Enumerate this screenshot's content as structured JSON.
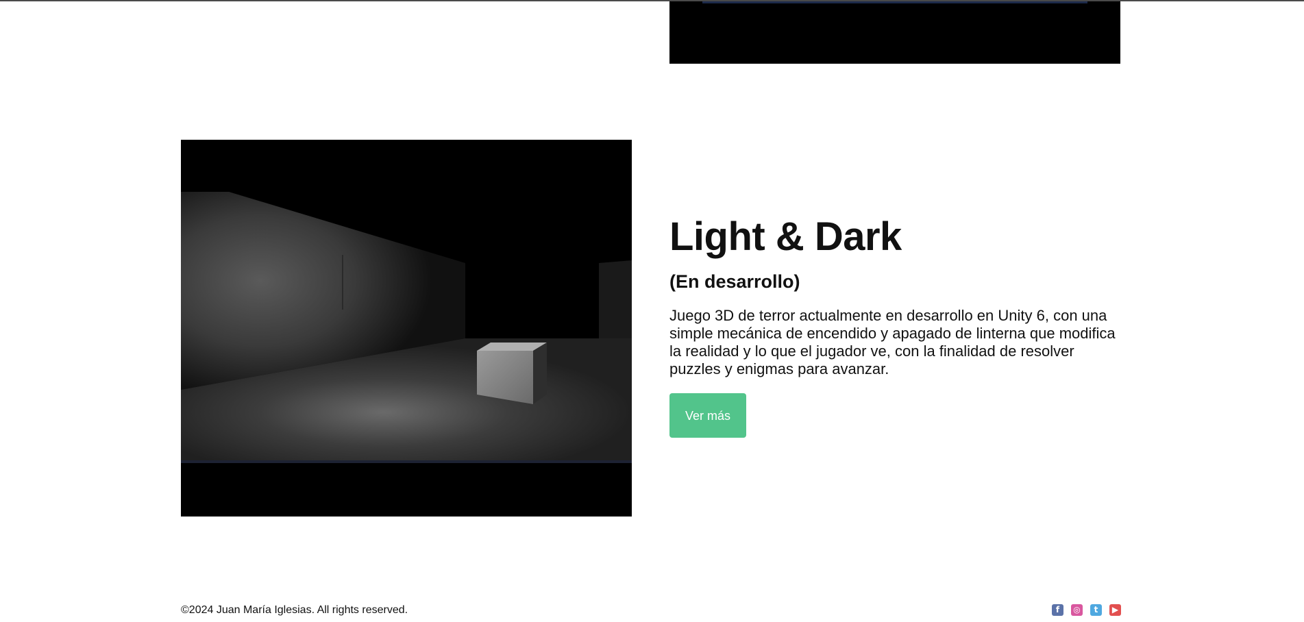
{
  "project": {
    "title": "Light & Dark",
    "status": "(En desarrollo)",
    "description": "Juego 3D de terror actualmente en desarrollo en Unity 6, con una simple mecánica de encendido y apagado de linterna que modifica la realidad y lo que el jugador ve, con la finalidad de resolver puzzles y enigmas para avanzar.",
    "button_label": "Ver más",
    "button_color": "#52c48b"
  },
  "footer": {
    "copyright": "©2024 Juan María Iglesias. All rights reserved.",
    "social": [
      {
        "name": "facebook-icon",
        "glyph": "f",
        "color": "#5b72a8"
      },
      {
        "name": "instagram-icon",
        "glyph": "◎",
        "color": "#d9579f"
      },
      {
        "name": "twitter-icon",
        "glyph": "t",
        "color": "#4fa8e0"
      },
      {
        "name": "youtube-icon",
        "glyph": "▶",
        "color": "#e25050"
      }
    ]
  }
}
